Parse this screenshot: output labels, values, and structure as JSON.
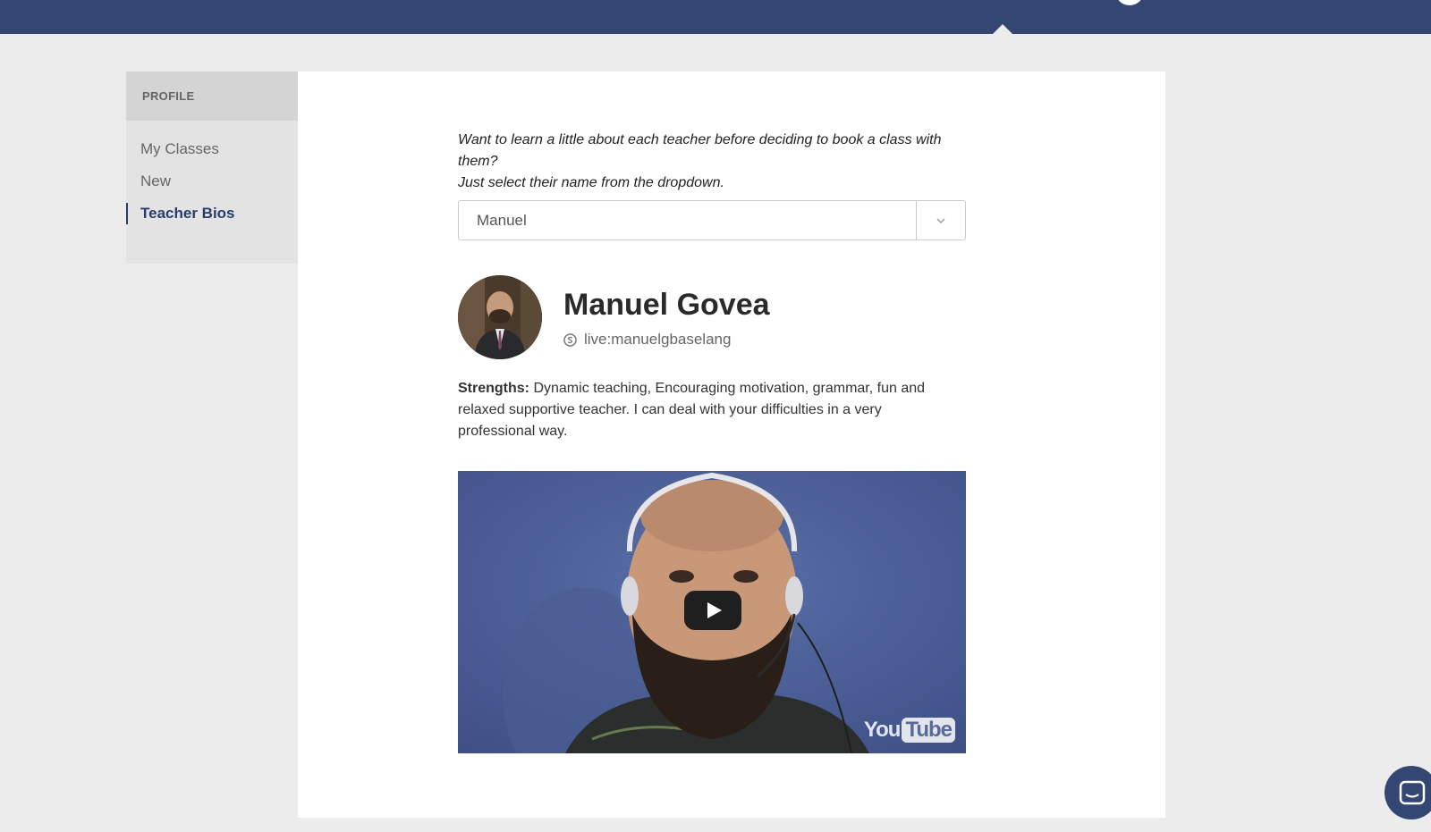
{
  "sidebar": {
    "heading": "PROFILE",
    "items": [
      {
        "label": "My Classes"
      },
      {
        "label": "New"
      },
      {
        "label": "Teacher Bios"
      }
    ]
  },
  "intro": {
    "line1": "Want to learn a little about each teacher before deciding to book a class with them?",
    "line2": "Just select their name from the dropdown."
  },
  "teacher_select": {
    "selected": "Manuel"
  },
  "teacher": {
    "name": "Manuel Govea",
    "skype": "live:manuelgbaselang",
    "strengths_label": "Strengths:",
    "strengths_text": "Dynamic teaching, Encouraging motivation, grammar, fun and relaxed supportive teacher. I can deal with your difficulties in a very professional way."
  },
  "video": {
    "logo_you": "You",
    "logo_tube": "Tube"
  },
  "colors": {
    "topbar": "#344772",
    "active_nav": "#283c6e",
    "background": "#ececec"
  },
  "icons": {
    "skype": "skype-icon",
    "dropdown": "chevron-down-icon",
    "play": "play-icon",
    "chat": "chat-icon"
  }
}
